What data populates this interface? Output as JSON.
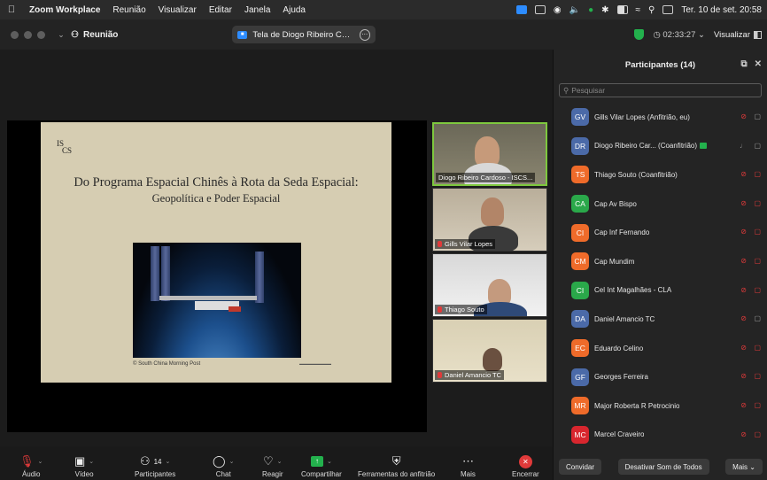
{
  "menubar": {
    "app": "Zoom Workplace",
    "items": [
      "Reunião",
      "Visualizar",
      "Editar",
      "Janela",
      "Ajuda"
    ],
    "clock": "Ter. 10 de set. 20:58"
  },
  "titlebar": {
    "meeting_label": "Reunião",
    "share_text": "Tela de Diogo Ribeiro Cardoso",
    "timer": "02:33:27",
    "view_label": "Visualizar"
  },
  "slide": {
    "logo_line1": "IS",
    "logo_line2": "CS",
    "title": "Do Programa Espacial Chinês à Rota da Seda Espacial:",
    "subtitle": "Geopolítica e Poder Espacial",
    "credit": "© South China Morning Post"
  },
  "videos": [
    {
      "name": "Diogo Ribeiro Cardoso - ISCS...",
      "muted": false
    },
    {
      "name": "Gills Vilar Lopes",
      "muted": true
    },
    {
      "name": "Thiago Souto",
      "muted": true
    },
    {
      "name": "Daniel Amancio TC",
      "muted": true
    }
  ],
  "toolbar": {
    "audio": "Áudio",
    "video": "Vídeo",
    "participants": "Participantes",
    "participants_count": "14",
    "chat": "Chat",
    "react": "Reagir",
    "share": "Compartilhar",
    "host_tools": "Ferramentas do anfitrião",
    "more": "Mais",
    "end": "Encerrar"
  },
  "panel": {
    "title": "Participantes (14)",
    "search_placeholder": "Pesquisar",
    "invite": "Convidar",
    "mute_all": "Desativar Som de Todos",
    "more": "Mais"
  },
  "participants": [
    {
      "initials": "GV",
      "name": "Gills Vilar Lopes (Anfitrião, eu)",
      "color": "#4b6aa8"
    },
    {
      "initials": "DR",
      "name": "Diogo Ribeiro Car... (Coanfitrião)",
      "color": "#4b6aa8"
    },
    {
      "initials": "TS",
      "name": "Thiago Souto (Coanfitrião)",
      "color": "#ef6b2a"
    },
    {
      "initials": "CA",
      "name": "Cap Av Bispo",
      "color": "#2aa84a"
    },
    {
      "initials": "CI",
      "name": "Cap Inf Fernando",
      "color": "#ef6b2a"
    },
    {
      "initials": "CM",
      "name": "Cap Mundim",
      "color": "#ef6b2a"
    },
    {
      "initials": "CI",
      "name": "Cel Int Magalhães - CLA",
      "color": "#2aa84a"
    },
    {
      "initials": "DA",
      "name": "Daniel Amancio TC",
      "color": "#4b6aa8"
    },
    {
      "initials": "EC",
      "name": "Eduardo Celino",
      "color": "#ef6b2a"
    },
    {
      "initials": "GF",
      "name": "Georges Ferreira",
      "color": "#4b6aa8"
    },
    {
      "initials": "MR",
      "name": "Major Roberta R Petrocinio",
      "color": "#ef6b2a"
    },
    {
      "initials": "MC",
      "name": "Marcel Craveiro",
      "color": "#d8262e"
    }
  ]
}
